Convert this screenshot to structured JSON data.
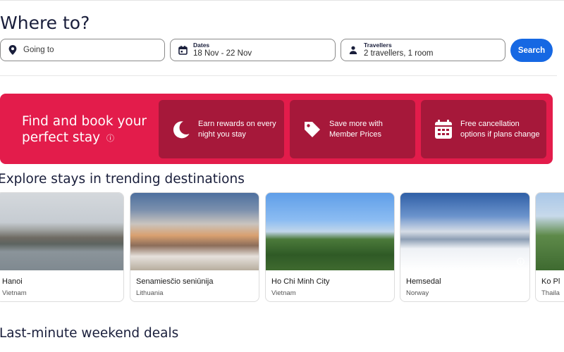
{
  "header": {
    "title": "Where to?"
  },
  "search": {
    "destination": {
      "placeholder": "Going to",
      "icon": "map-pin-icon"
    },
    "dates": {
      "label": "Dates",
      "value": "18 Nov - 22 Nov",
      "icon": "calendar-icon"
    },
    "travellers": {
      "label": "Travellers",
      "value": "2 travellers, 1 room",
      "icon": "person-icon"
    },
    "button_label": "Search"
  },
  "promo": {
    "headline": "Find and book your perfect stay",
    "features": [
      {
        "icon": "moon-icon",
        "text": "Earn rewards on every night you stay"
      },
      {
        "icon": "price-tag-icon",
        "text": "Save more with Member Prices"
      },
      {
        "icon": "calendar-grid-icon",
        "text": "Free cancellation options if plans change"
      }
    ]
  },
  "trending": {
    "heading": "Explore stays in trending destinations",
    "destinations": [
      {
        "name": "Hanoi",
        "country": "Vietnam"
      },
      {
        "name": "Senamiesčio seniūnija",
        "country": "Lithuania"
      },
      {
        "name": "Ho Chi Minh City",
        "country": "Vietnam"
      },
      {
        "name": "Hemsedal",
        "country": "Norway"
      },
      {
        "name": "Ko Pl",
        "country": "Thaila"
      }
    ]
  },
  "deals": {
    "heading": "Last-minute weekend deals"
  },
  "colors": {
    "brand_red": "#e31c4b",
    "feature_red": "#a6183a",
    "accent_blue": "#1668e3",
    "heading": "#191e3b"
  }
}
